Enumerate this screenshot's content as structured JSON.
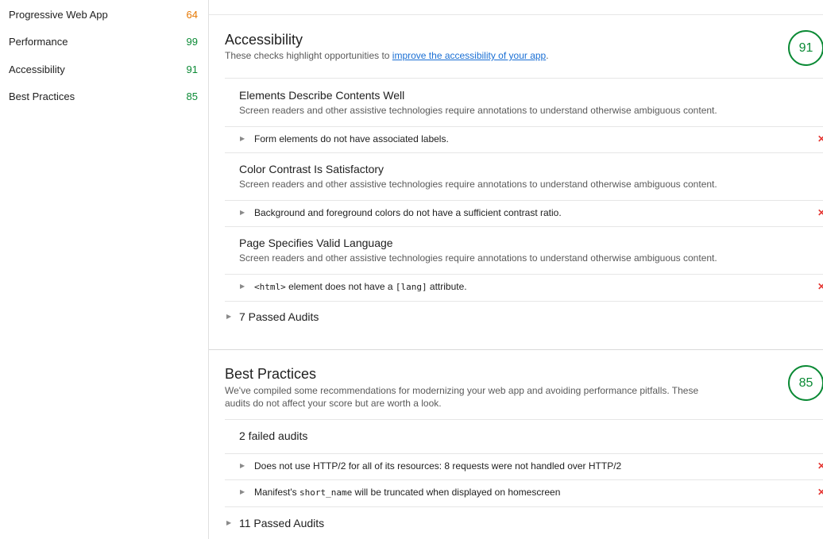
{
  "sidebar": {
    "items": [
      {
        "label": "Progressive Web App",
        "score": "64"
      },
      {
        "label": "Performance",
        "score": "99"
      },
      {
        "label": "Accessibility",
        "score": "91"
      },
      {
        "label": "Best Practices",
        "score": "85"
      }
    ]
  },
  "accessibility": {
    "title": "Accessibility",
    "desc_prefix": "These checks highlight opportunities to ",
    "desc_link": "improve the accessibility of your app",
    "desc_suffix": ".",
    "score": "91",
    "groups": [
      {
        "title": "Elements Describe Contents Well",
        "desc": "Screen readers and other assistive technologies require annotations to understand otherwise ambiguous content.",
        "audit": "Form elements do not have associated labels."
      },
      {
        "title": "Color Contrast Is Satisfactory",
        "desc": "Screen readers and other assistive technologies require annotations to understand otherwise ambiguous content.",
        "audit": "Background and foreground colors do not have a sufficient contrast ratio."
      },
      {
        "title": "Page Specifies Valid Language",
        "desc": "Screen readers and other assistive technologies require annotations to understand otherwise ambiguous content.",
        "audit_code1": "<html>",
        "audit_mid": " element does not have a ",
        "audit_code2": "[lang]",
        "audit_end": " attribute."
      }
    ],
    "passed": "7 Passed Audits"
  },
  "best_practices": {
    "title": "Best Practices",
    "desc_line1": "We've compiled some recommendations for modernizing your web app and avoiding performance pitfalls. These",
    "desc_line2": "audits do not affect your score but are worth a look.",
    "score": "85",
    "failed_label": "2 failed audits",
    "audit1": "Does not use HTTP/2 for all of its resources: 8 requests were not handled over HTTP/2",
    "audit2_prefix": "Manifest's ",
    "audit2_code": "short_name",
    "audit2_suffix": " will be truncated when displayed on homescreen",
    "passed": "11 Passed Audits"
  },
  "icons": {
    "expand": "▶",
    "fail": "✕"
  },
  "colors": {
    "score_orange": "#e67700",
    "score_green": "#0b8a35",
    "fail_red": "#e53935",
    "link_blue": "#1a6fd4"
  }
}
